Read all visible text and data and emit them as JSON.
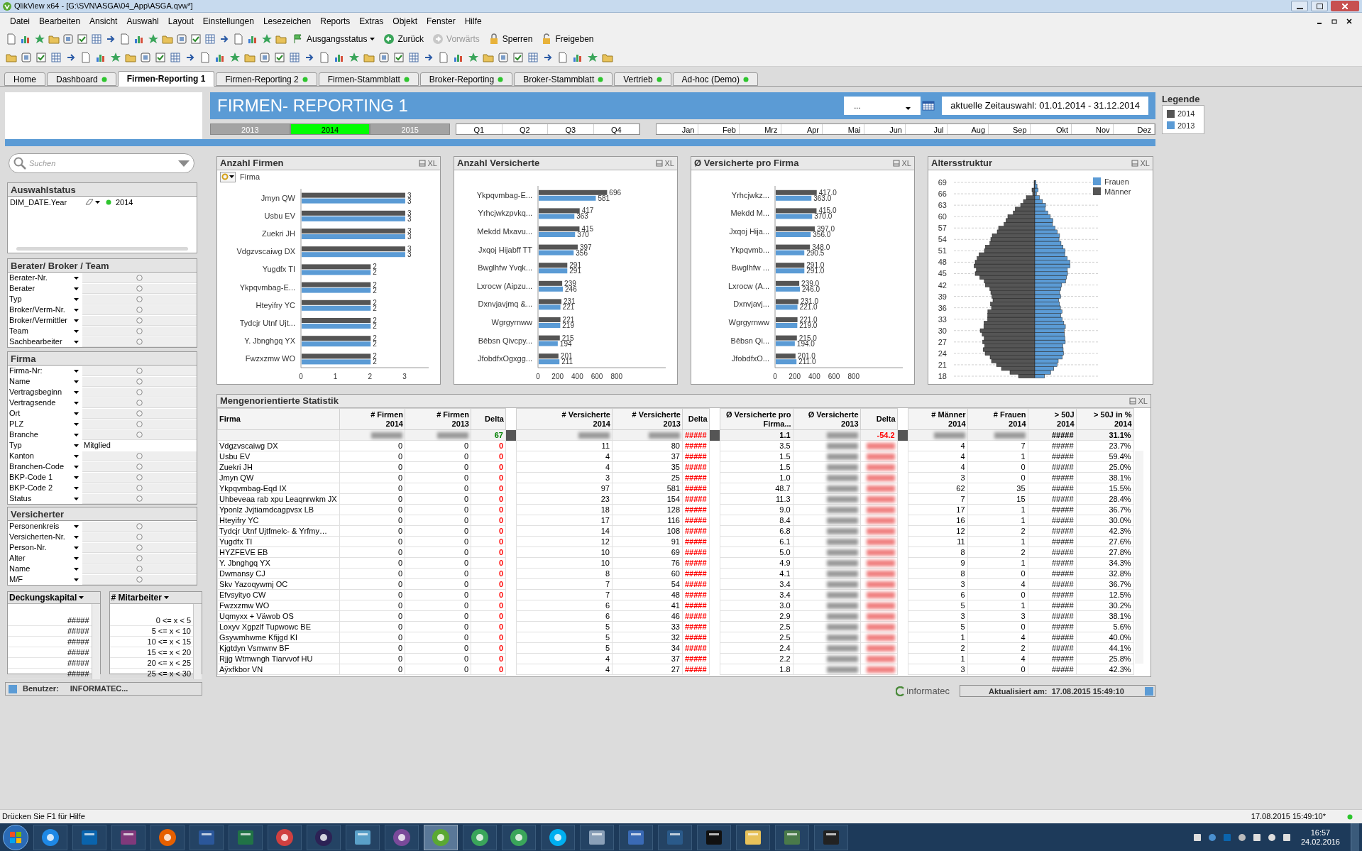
{
  "window": {
    "title": "QlikView x64 - [G:\\SVN\\ASGA\\04_App\\ASGA.qvw*]"
  },
  "menu": [
    "Datei",
    "Bearbeiten",
    "Ansicht",
    "Auswahl",
    "Layout",
    "Einstellungen",
    "Lesezeichen",
    "Reports",
    "Extras",
    "Objekt",
    "Fenster",
    "Hilfe"
  ],
  "toolbar": {
    "buttons": [
      {
        "label": "Ausgangsstatus",
        "kind": "dropdown",
        "disabled": false
      },
      {
        "label": "Zurück",
        "kind": "back",
        "disabled": false
      },
      {
        "label": "Vorwärts",
        "kind": "forward",
        "disabled": true
      },
      {
        "label": "Sperren",
        "kind": "lock",
        "disabled": false
      },
      {
        "label": "Freigeben",
        "kind": "unlock",
        "disabled": false
      }
    ]
  },
  "tabs": [
    {
      "label": "Home",
      "selected": false,
      "dot": false
    },
    {
      "label": "Dashboard",
      "selected": false,
      "dot": true
    },
    {
      "label": "Firmen-Reporting 1",
      "selected": true,
      "dot": false
    },
    {
      "label": "Firmen-Reporting 2",
      "selected": false,
      "dot": true
    },
    {
      "label": "Firmen-Stammblatt",
      "selected": false,
      "dot": true
    },
    {
      "label": "Broker-Reporting",
      "selected": false,
      "dot": true
    },
    {
      "label": "Broker-Stammblatt",
      "selected": false,
      "dot": true
    },
    {
      "label": "Vertrieb",
      "selected": false,
      "dot": true
    },
    {
      "label": "Ad-hoc (Demo)",
      "selected": false,
      "dot": true
    }
  ],
  "header": {
    "title": "FIRMEN- REPORTING 1",
    "dropdown_value": "...",
    "time_selection": "aktuelle Zeitauswahl: 01.01.2014 - 31.12.2014"
  },
  "years": [
    {
      "label": "2013",
      "selected": false
    },
    {
      "label": "2014",
      "selected": true
    },
    {
      "label": "2015",
      "selected": false
    }
  ],
  "quarters": [
    "Q1",
    "Q2",
    "Q3",
    "Q4"
  ],
  "months": [
    "Jan",
    "Feb",
    "Mrz",
    "Apr",
    "Mai",
    "Jun",
    "Jul",
    "Aug",
    "Sep",
    "Okt",
    "Nov",
    "Dez"
  ],
  "legend": {
    "title": "Legende",
    "items": [
      {
        "label": "2014",
        "color": "#555555"
      },
      {
        "label": "2013",
        "color": "#5b9bd5"
      }
    ]
  },
  "search": {
    "placeholder": "Suchen"
  },
  "selection_status": {
    "title": "Auswahlstatus",
    "items": [
      {
        "field": "DIM_DATE.Year",
        "value": "2014"
      }
    ]
  },
  "listboxes": [
    {
      "title": "Berater/ Broker / Team",
      "fields": [
        {
          "label": "Berater-Nr."
        },
        {
          "label": "Berater"
        },
        {
          "label": "Typ"
        },
        {
          "label": "Broker/Verm-Nr."
        },
        {
          "label": "Broker/Vermittler"
        },
        {
          "label": "Team"
        },
        {
          "label": "Sachbearbeiter"
        }
      ]
    },
    {
      "title": "Firma",
      "fields": [
        {
          "label": "Firma-Nr:"
        },
        {
          "label": "Name"
        },
        {
          "label": "Vertragsbeginn"
        },
        {
          "label": "Vertragsende"
        },
        {
          "label": "Ort"
        },
        {
          "label": "PLZ"
        },
        {
          "label": "Branche"
        },
        {
          "label": "Typ",
          "value": "Mitglied"
        },
        {
          "label": "Kanton"
        },
        {
          "label": "Branchen-Code"
        },
        {
          "label": "BKP-Code 1"
        },
        {
          "label": "BKP-Code 2"
        },
        {
          "label": "Status"
        }
      ]
    },
    {
      "title": "Versicherter",
      "fields": [
        {
          "label": "Personenkreis"
        },
        {
          "label": "Versicherten-Nr."
        },
        {
          "label": "Person-Nr."
        },
        {
          "label": "Alter"
        },
        {
          "label": "Name"
        },
        {
          "label": "M/F"
        }
      ]
    }
  ],
  "small_lists": [
    {
      "title": "Deckungskapital",
      "values": [
        "#####",
        "#####",
        "#####",
        "#####",
        "#####",
        "#####"
      ]
    },
    {
      "title": "# Mitarbeiter",
      "values": [
        "0 <= x < 5",
        "5 <= x < 10",
        "10 <= x < 15",
        "15 <= x < 20",
        "20 <= x < 25",
        "25 <= x < 30"
      ]
    }
  ],
  "user_status": {
    "label": "Benutzer:",
    "value": "INFORMATEC..."
  },
  "charts": [
    {
      "title": "Anzahl Firmen",
      "cycle_label": "Firma",
      "export_label": "XL",
      "chart_data": {
        "type": "bar",
        "orientation": "horizontal",
        "categories": [
          "Jmyn QW",
          "Usbu EV",
          "Zuekri JH",
          "Vdgzvscaiwg DX",
          "Yugdfx TI",
          "Ykpqvmbag-E...",
          "Hteyifry YC",
          "Tydcjr Utnf Ujt...",
          "Y. Jbnghgq YX",
          "Fwzxzmw WO"
        ],
        "series": [
          {
            "color": "#555555",
            "values": [
              3,
              3,
              3,
              3,
              2,
              2,
              2,
              2,
              2,
              2
            ]
          },
          {
            "color": "#5b9bd5",
            "values": [
              3,
              3,
              3,
              3,
              2,
              2,
              2,
              2,
              2,
              2
            ]
          }
        ],
        "xlim": [
          0,
          3.7
        ],
        "xticks": [
          0,
          1,
          2,
          3
        ],
        "value_labels": [
          [
            "3",
            "3",
            "3",
            "3",
            "2",
            "2",
            "2",
            "2",
            "2",
            "2"
          ],
          [
            "3",
            "3",
            "3",
            "3",
            "2",
            "2",
            "2",
            "2",
            "2",
            "2"
          ]
        ]
      }
    },
    {
      "title": "Anzahl Versicherte",
      "export_label": "XL",
      "chart_data": {
        "type": "bar",
        "orientation": "horizontal",
        "categories": [
          "Ykpqvmbag-E...",
          "Yrhcjwkzpvkq...",
          "Mekdd Mxavu...",
          "Jxqoj Hijabff TT",
          "Bwglhfw Yvqk...",
          "Lxrocw (Aipzu...",
          "Dxnvjavjmq &...",
          "Wgrgyrnww",
          "Bêbsn Qivcpy...",
          "JfobdfxOgxgg..."
        ],
        "series": [
          {
            "color": "#555555",
            "values": [
              696,
              417,
              415,
              397,
              291,
              239,
              231,
              221,
              215,
              201
            ]
          },
          {
            "color": "#5b9bd5",
            "values": [
              581,
              363,
              370,
              356,
              291,
              246,
              221,
              219,
              194,
              211
            ]
          }
        ],
        "xlim": [
          0,
          1300
        ],
        "xticks": [
          0,
          200,
          400,
          600,
          800
        ],
        "value_labels": [
          [
            "696",
            "417",
            "415",
            "397",
            "291",
            "239",
            "231",
            "221",
            "215",
            "201"
          ],
          [
            "581",
            "363",
            "370",
            "356",
            "291",
            "246",
            "221",
            "219",
            "194",
            "211"
          ]
        ]
      }
    },
    {
      "title": "Ø Versicherte pro Firma",
      "export_label": "XL",
      "chart_data": {
        "type": "bar",
        "orientation": "horizontal",
        "categories": [
          "Yrhcjwkz...",
          "Mekdd M...",
          "Jxqoj Hija...",
          "Ykpqvmb...",
          "Bwglhfw ...",
          "Lxrocw (A...",
          "Dxnvjavj...",
          "Wgrgyrnww",
          "Bêbsn Qi...",
          "JfobdfxO..."
        ],
        "series": [
          {
            "color": "#555555",
            "values": [
              417,
              415,
              397,
              348,
              291,
              239,
              231,
              221,
              215,
              201
            ]
          },
          {
            "color": "#5b9bd5",
            "values": [
              363,
              370,
              356,
              290.5,
              291,
              246,
              221,
              219,
              194,
              211
            ]
          }
        ],
        "xlim": [
          0,
          1300
        ],
        "xticks": [
          0,
          200,
          400,
          600,
          800
        ],
        "value_labels": [
          [
            "417.0",
            "415.0",
            "397.0",
            "348.0",
            "291.0",
            "239.0",
            "231.0",
            "221.0",
            "215.0",
            "201.0"
          ],
          [
            "363.0",
            "370.0",
            "356.0",
            "290.5",
            "291.0",
            "246.0",
            "221.0",
            "219.0",
            "194.0",
            "211.0"
          ]
        ]
      }
    }
  ],
  "age_chart": {
    "title": "Altersstruktur",
    "export_label": "XL",
    "age_ticks": [
      "69",
      "66",
      "63",
      "60",
      "57",
      "54",
      "51",
      "48",
      "45",
      "42",
      "39",
      "36",
      "33",
      "30",
      "27",
      "24",
      "21",
      "18"
    ],
    "legend": [
      {
        "label": "Frauen",
        "color": "#5b9bd5"
      },
      {
        "label": "Männer",
        "color": "#555555"
      }
    ]
  },
  "table": {
    "title": "Mengenorientierte Statistik",
    "export_label": "XL",
    "columns": [
      {
        "label": [
          "Firma"
        ],
        "kind": "text"
      },
      {
        "label": [
          "# Firmen",
          "2014"
        ],
        "kind": "number"
      },
      {
        "label": [
          "# Firmen",
          "2013"
        ],
        "kind": "number"
      },
      {
        "label": [
          "Delta"
        ],
        "kind": "delta",
        "separator_after": true
      },
      {
        "label": [
          "# Versicherte",
          "2014"
        ],
        "kind": "number"
      },
      {
        "label": [
          "# Versicherte",
          "2013"
        ],
        "kind": "number"
      },
      {
        "label": [
          "Delta"
        ],
        "kind": "delta",
        "separator_after": true
      },
      {
        "label": [
          "Ø Versicherte pro",
          "Firma..."
        ],
        "kind": "number"
      },
      {
        "label": [
          "Ø Versicherte",
          "2013"
        ],
        "kind": "number",
        "blurred": true
      },
      {
        "label": [
          "Delta"
        ],
        "kind": "delta",
        "separator_after": true,
        "blurred": true
      },
      {
        "label": [
          "# Männer",
          "2014"
        ],
        "kind": "number"
      },
      {
        "label": [
          "# Frauen",
          "2014"
        ],
        "kind": "number"
      },
      {
        "label": [
          "> 50J",
          "2014"
        ],
        "kind": "number"
      },
      {
        "label": [
          "> 50J in %",
          "2014"
        ],
        "kind": "number"
      }
    ],
    "totals": [
      {
        "blurred": true
      },
      {
        "blurred": true
      },
      {
        "blurred": false,
        "text": "67",
        "color": "#008000"
      },
      {
        "blurred": true
      },
      {
        "blurred": true
      },
      {
        "blurred": false,
        "text": "#####",
        "color": "#ff0000"
      },
      {
        "blurred": false,
        "text": "1.1"
      },
      {
        "blurred": true
      },
      {
        "blurred": false,
        "text": "-54.2",
        "color": "#ff0000"
      },
      {
        "blurred": true
      },
      {
        "blurred": true
      },
      {
        "blurred": false,
        "text": "#####"
      },
      {
        "blurred": false,
        "text": "31.1%"
      }
    ],
    "rows": [
      [
        "Vdgzvscaiwg DX",
        "0",
        "0",
        "0",
        "11",
        "80",
        "#####",
        "3.5",
        "",
        "",
        "4",
        "7",
        "#####",
        "23.7%"
      ],
      [
        "Usbu EV",
        "0",
        "0",
        "0",
        "4",
        "37",
        "#####",
        "1.5",
        "",
        "",
        "4",
        "1",
        "#####",
        "59.4%"
      ],
      [
        "Zuekri JH",
        "0",
        "0",
        "0",
        "4",
        "35",
        "#####",
        "1.5",
        "",
        "",
        "4",
        "0",
        "#####",
        "25.0%"
      ],
      [
        "Jmyn QW",
        "0",
        "0",
        "0",
        "3",
        "25",
        "#####",
        "1.0",
        "",
        "",
        "3",
        "0",
        "#####",
        "38.1%"
      ],
      [
        "Ykpqvmbag-Eqd IX",
        "0",
        "0",
        "0",
        "97",
        "581",
        "#####",
        "48.7",
        "",
        "",
        "62",
        "35",
        "#####",
        "15.5%"
      ],
      [
        "Uhbeveaa rab xpu Leaqnrwkm JX",
        "0",
        "0",
        "0",
        "23",
        "154",
        "#####",
        "11.3",
        "",
        "",
        "7",
        "15",
        "#####",
        "28.4%"
      ],
      [
        "Yponlz Jvjtiamdcagpvsx LB",
        "0",
        "0",
        "0",
        "18",
        "128",
        "#####",
        "9.0",
        "",
        "",
        "17",
        "1",
        "#####",
        "36.7%"
      ],
      [
        "Hteyifry YC",
        "0",
        "0",
        "0",
        "17",
        "116",
        "#####",
        "8.4",
        "",
        "",
        "16",
        "1",
        "#####",
        "30.0%"
      ],
      [
        "Tydcjr Utnf Ujtfmelc- & Yrfmy…",
        "0",
        "0",
        "0",
        "14",
        "108",
        "#####",
        "6.8",
        "",
        "",
        "12",
        "2",
        "#####",
        "42.3%"
      ],
      [
        "Yugdfx TI",
        "0",
        "0",
        "0",
        "12",
        "91",
        "#####",
        "6.1",
        "",
        "",
        "11",
        "1",
        "#####",
        "27.6%"
      ],
      [
        "HYZFEVE EB",
        "0",
        "0",
        "0",
        "10",
        "69",
        "#####",
        "5.0",
        "",
        "",
        "8",
        "2",
        "#####",
        "27.8%"
      ],
      [
        "Y. Jbnghgq YX",
        "0",
        "0",
        "0",
        "10",
        "76",
        "#####",
        "4.9",
        "",
        "",
        "9",
        "1",
        "#####",
        "34.3%"
      ],
      [
        "Dwmansy CJ",
        "0",
        "0",
        "0",
        "8",
        "60",
        "#####",
        "4.1",
        "",
        "",
        "8",
        "0",
        "#####",
        "32.8%"
      ],
      [
        "Skv Yazoqywmj OC",
        "0",
        "0",
        "0",
        "7",
        "54",
        "#####",
        "3.4",
        "",
        "",
        "3",
        "4",
        "#####",
        "36.7%"
      ],
      [
        "Efvsyityo CW",
        "0",
        "0",
        "0",
        "7",
        "48",
        "#####",
        "3.4",
        "",
        "",
        "6",
        "0",
        "#####",
        "12.5%"
      ],
      [
        "Fwzxzmw WO",
        "0",
        "0",
        "0",
        "6",
        "41",
        "#####",
        "3.0",
        "",
        "",
        "5",
        "1",
        "#####",
        "30.2%"
      ],
      [
        "Uqmyxx + Väwob OS",
        "0",
        "0",
        "0",
        "6",
        "46",
        "#####",
        "2.9",
        "",
        "",
        "3",
        "3",
        "#####",
        "38.1%"
      ],
      [
        "Loxyv Xgpzlf Tupwowc BE",
        "0",
        "0",
        "0",
        "5",
        "33",
        "#####",
        "2.5",
        "",
        "",
        "5",
        "0",
        "#####",
        "5.6%"
      ],
      [
        "Gsywmhwme Kfijgd KI",
        "0",
        "0",
        "0",
        "5",
        "32",
        "#####",
        "2.5",
        "",
        "",
        "1",
        "4",
        "#####",
        "40.0%"
      ],
      [
        "Kjgtdyn Vsmwnv BF",
        "0",
        "0",
        "0",
        "5",
        "34",
        "#####",
        "2.4",
        "",
        "",
        "2",
        "2",
        "#####",
        "44.1%"
      ],
      [
        "Rjjg Wtmwngh Tiarvvof HU",
        "0",
        "0",
        "0",
        "4",
        "37",
        "#####",
        "2.2",
        "",
        "",
        "1",
        "4",
        "#####",
        "25.8%"
      ],
      [
        "Aÿxfkbor VN",
        "0",
        "0",
        "0",
        "4",
        "27",
        "#####",
        "1.8",
        "",
        "",
        "3",
        "0",
        "#####",
        "42.3%"
      ]
    ]
  },
  "footer": {
    "brand": "informatec",
    "updated": "Aktualisiert am:  17.08.2015 15:49:10"
  },
  "status_bar": {
    "hint": "Drücken Sie F1 für Hilfe",
    "timestamp": "17.08.2015 15:49:10*"
  },
  "taskbar": {
    "time": "16:57",
    "date": "24.02.2016"
  }
}
